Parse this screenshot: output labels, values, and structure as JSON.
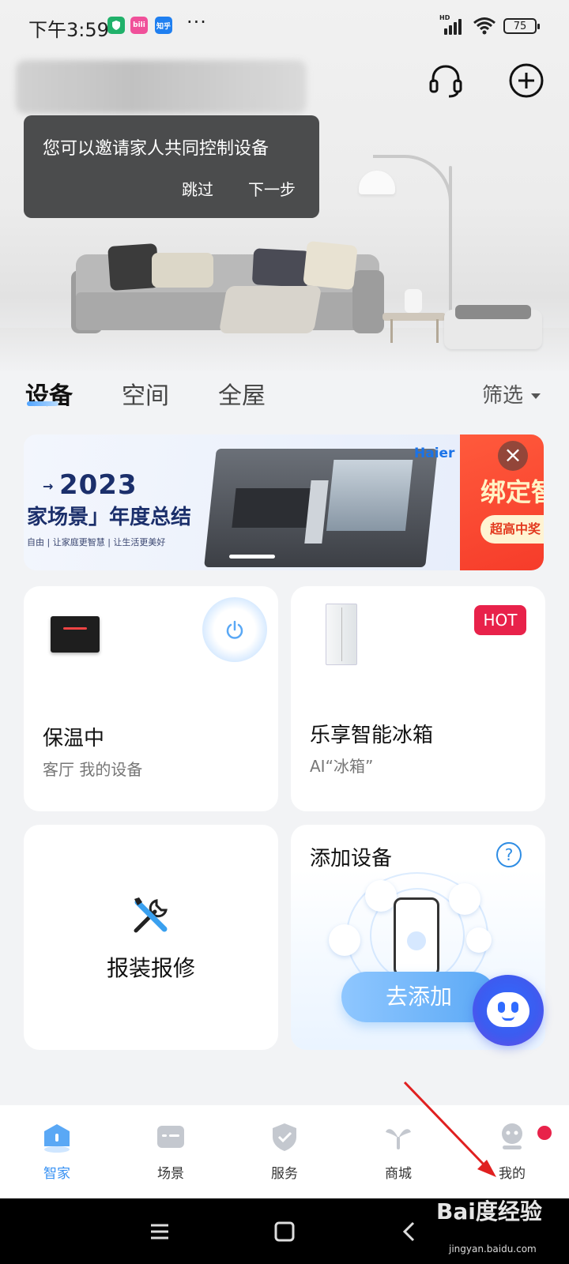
{
  "status_bar": {
    "time": "下午3:59",
    "app_icons": [
      {
        "name": "shield-app-icon",
        "color": "#20b16a",
        "text": ""
      },
      {
        "name": "bilibili-app-icon",
        "color": "#f0509a",
        "text": "bili"
      },
      {
        "name": "zhihu-app-icon",
        "color": "#1f7ff0",
        "text": "知乎"
      }
    ],
    "more": "···",
    "network": "HD",
    "battery": "75"
  },
  "header": {
    "support_icon": "headset-icon",
    "add_icon": "plus-circle-icon"
  },
  "tooltip": {
    "text": "您可以邀请家人共同控制设备",
    "skip": "跳过",
    "next": "下一步"
  },
  "tabs": {
    "items": [
      {
        "label": "设备",
        "active": true
      },
      {
        "label": "空间",
        "active": false
      },
      {
        "label": "全屋",
        "active": false
      }
    ],
    "filter": "筛选"
  },
  "banner": {
    "year": "2023",
    "title": "家场景」年度总结",
    "subtitle": "自由 | 让家庭更智慧 | 让生活更美好",
    "brand": "Haier",
    "promo_title": "绑定智",
    "promo_button": "超高中奖",
    "close": "×"
  },
  "cards": {
    "heater": {
      "status": "保温中",
      "location": "客厅 我的设备"
    },
    "fridge": {
      "badge": "HOT",
      "title": "乐享智能冰箱",
      "subtitle": "AI“冰箱”"
    },
    "repair": {
      "label": "报装报修"
    },
    "add_device": {
      "title": "添加设备",
      "help": "?",
      "button": "去添加"
    }
  },
  "bottom_nav": [
    {
      "label": "智家",
      "icon": "home-icon",
      "active": true
    },
    {
      "label": "场景",
      "icon": "scene-icon",
      "active": false
    },
    {
      "label": "服务",
      "icon": "service-shield-icon",
      "active": false
    },
    {
      "label": "商城",
      "icon": "mall-icon",
      "active": false
    },
    {
      "label": "我的",
      "icon": "profile-icon",
      "active": false
    }
  ],
  "watermark": {
    "text": "Bai度经验",
    "url": "jingyan.baidu.com"
  },
  "colors": {
    "accent": "#3590f3",
    "badge": "#e8224a",
    "annotation_arrow": "#e02020"
  }
}
